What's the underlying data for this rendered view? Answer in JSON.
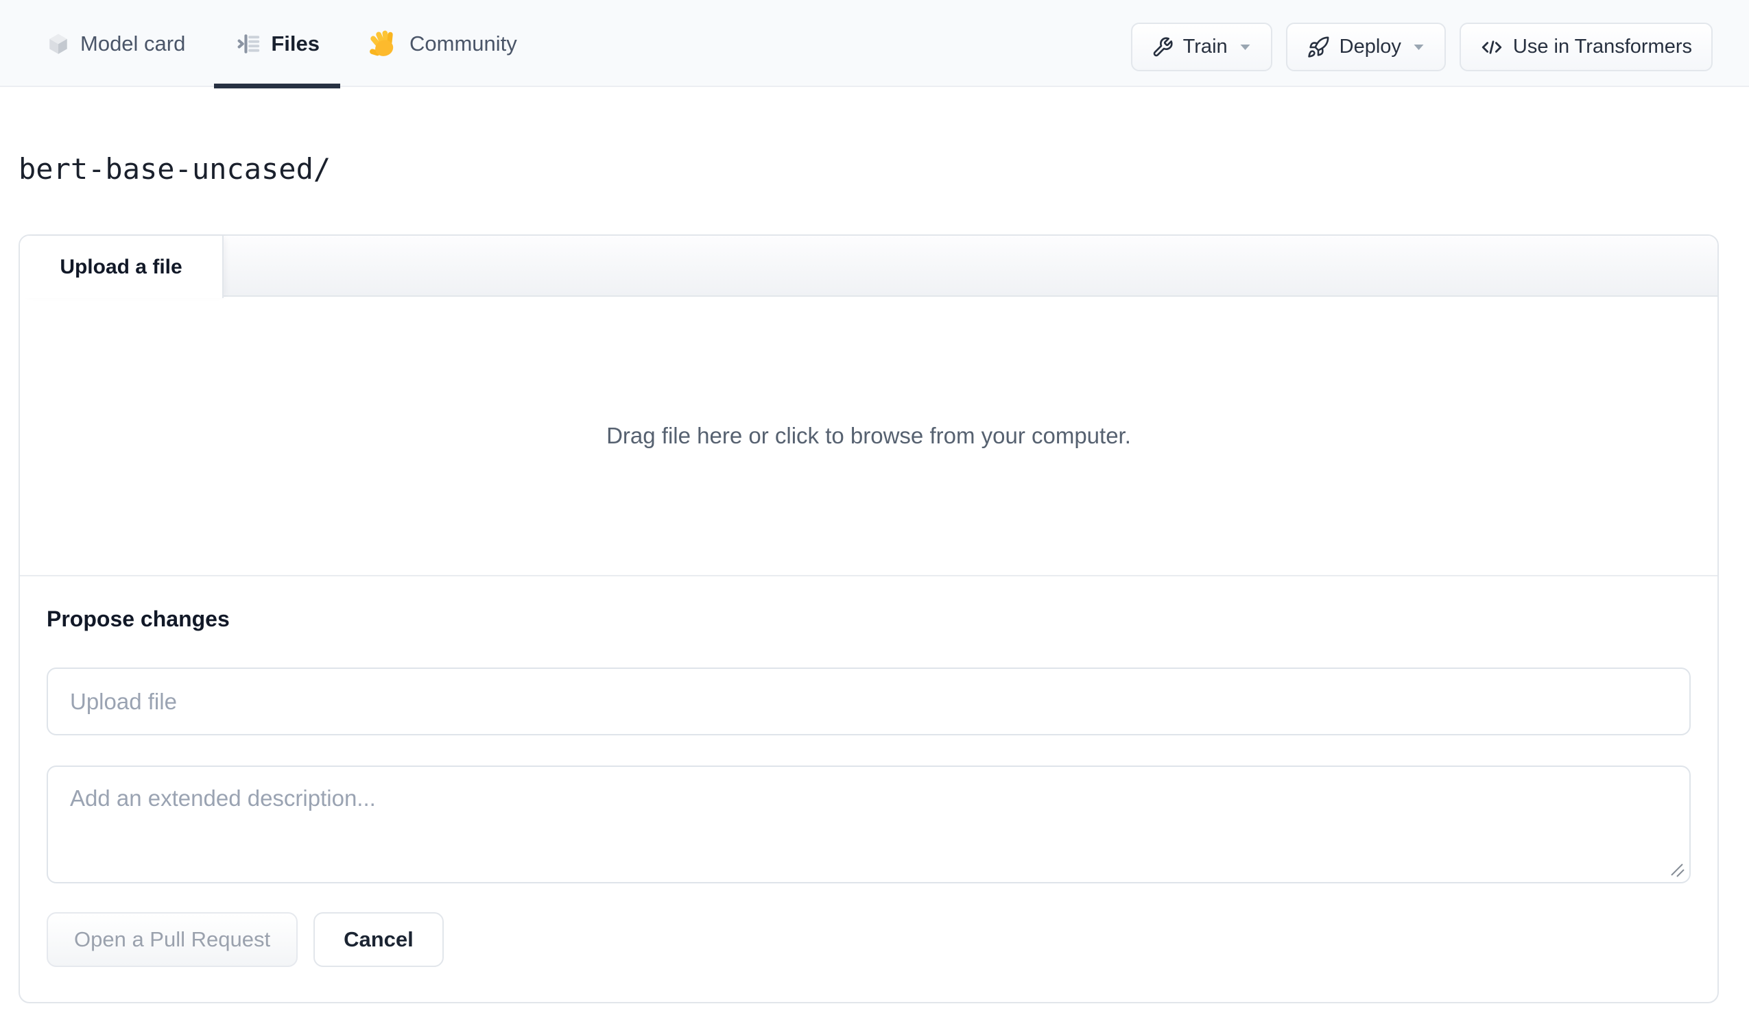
{
  "nav": {
    "tabs": [
      {
        "label": "Model card",
        "icon": "cube-icon",
        "active": false
      },
      {
        "label": "Files",
        "icon": "files-list-icon",
        "active": true
      },
      {
        "label": "Community",
        "icon": "waving-hand-icon",
        "active": false
      }
    ],
    "actions": [
      {
        "label": "Train",
        "icon": "wrench-icon",
        "has_caret": true
      },
      {
        "label": "Deploy",
        "icon": "rocket-icon",
        "has_caret": true
      },
      {
        "label": "Use in Transformers",
        "icon": "code-icon",
        "has_caret": false
      }
    ]
  },
  "breadcrumb": {
    "path": "bert-base-uncased/"
  },
  "panel": {
    "tab_label": "Upload a file",
    "dropzone_text": "Drag file here or click to browse from your computer.",
    "propose": {
      "heading": "Propose changes",
      "filename_placeholder": "Upload file",
      "description_placeholder": "Add an extended description...",
      "submit_label": "Open a Pull Request",
      "cancel_label": "Cancel"
    }
  },
  "colors": {
    "nav_background": "#f8fafc",
    "nav_border": "#eceef2",
    "active_tab_underline": "#273142",
    "text_primary": "#1a202c",
    "text_secondary": "#4a5568",
    "placeholder": "#9aa3b2",
    "panel_border": "#e2e6eb",
    "disabled_button_text": "#9aa1ad",
    "hand_emoji_yellow": "#fdbA2d"
  }
}
